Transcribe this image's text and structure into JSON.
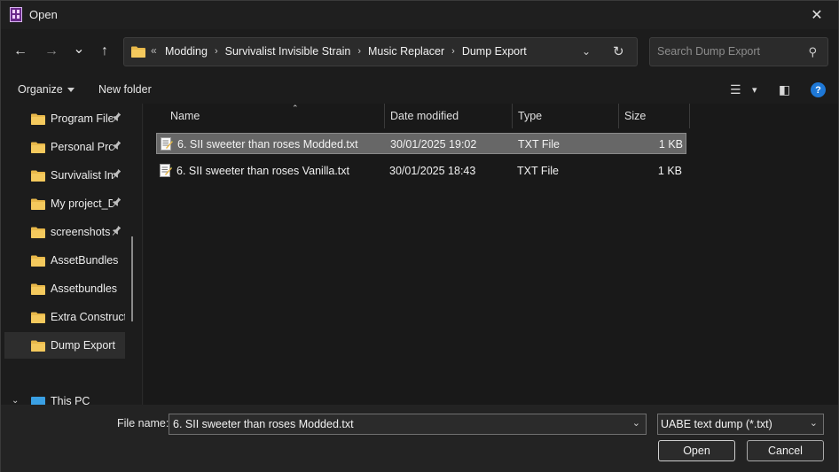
{
  "window": {
    "title": "Open",
    "close_glyph": "✕"
  },
  "nav": {
    "back_glyph": "←",
    "forward_glyph": "→",
    "recent_glyph": "⌄",
    "up_glyph": "↑",
    "address_overflow": "«",
    "breadcrumbs": [
      "Modding",
      "Survivalist Invisible Strain",
      "Music Replacer",
      "Dump Export"
    ],
    "crumb_separator": "›",
    "address_dropdown": "⌄",
    "refresh_glyph": "↻",
    "search_placeholder": "Search Dump Export",
    "search_glyph": "⚲"
  },
  "commandbar": {
    "organize_label": "Organize",
    "new_folder_label": "New folder",
    "view_glyph": "☰",
    "view_caret": "▾",
    "preview_glyph": "◧",
    "help_glyph": "?"
  },
  "sidebar": {
    "items": [
      {
        "label": "Program Files",
        "pinned": true
      },
      {
        "label": "Personal Proj",
        "pinned": true
      },
      {
        "label": "Survivalist Inv",
        "pinned": true
      },
      {
        "label": "My project_D",
        "pinned": true
      },
      {
        "label": "screenshots",
        "pinned": true
      },
      {
        "label": "AssetBundles",
        "pinned": false
      },
      {
        "label": "Assetbundles",
        "pinned": false
      },
      {
        "label": "Extra Constructi",
        "pinned": false
      },
      {
        "label": "Dump Export",
        "pinned": false,
        "selected": true
      }
    ],
    "pin_glyph": "📌",
    "this_pc_label": "This PC",
    "this_pc_chevron": "⌄"
  },
  "filelist": {
    "columns": [
      "Name",
      "Date modified",
      "Type",
      "Size"
    ],
    "sort_glyph": "⌃",
    "rows": [
      {
        "name": "6. SII sweeter than roses Modded.txt",
        "date": "30/01/2025 19:02",
        "type": "TXT File",
        "size": "1 KB",
        "selected": true
      },
      {
        "name": "6. SII sweeter than roses Vanilla.txt",
        "date": "30/01/2025 18:43",
        "type": "TXT File",
        "size": "1 KB",
        "selected": false
      }
    ]
  },
  "footer": {
    "file_name_label": "File name:",
    "file_name_value": "6. SII sweeter than roses Modded.txt",
    "file_type_value": "UABE text dump (*.txt)",
    "dropdown_glyph": "⌄",
    "open_label": "Open",
    "cancel_label": "Cancel"
  },
  "colors": {
    "folder": "#e8b84a",
    "accent": "#1e78d7",
    "background": "#1c1c1c"
  }
}
